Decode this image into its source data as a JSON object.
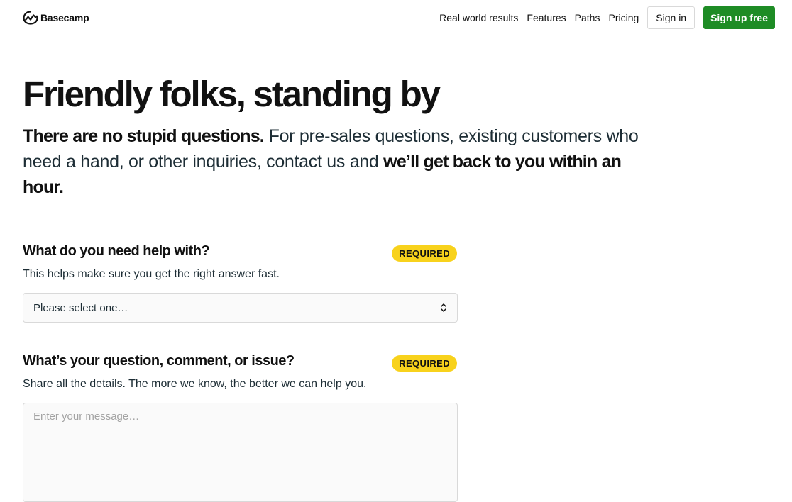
{
  "header": {
    "logo_text": "Basecamp",
    "nav": [
      {
        "label": "Real world results"
      },
      {
        "label": "Features"
      },
      {
        "label": "Paths"
      },
      {
        "label": "Pricing"
      }
    ],
    "signin_label": "Sign in",
    "signup_label": "Sign up free",
    "brand_green": "#1e8c25"
  },
  "hero": {
    "title": "Friendly folks, standing by",
    "intro_bold_1": "There are no stupid questions.",
    "intro_text": " For pre-sales questions, existing customers who need a hand, or other inquiries, contact us and ",
    "intro_bold_2": "we’ll get back to you within an hour."
  },
  "form": {
    "help_topic": {
      "label": "What do you need help with?",
      "badge": "REQUIRED",
      "help": "This helps make sure you get the right answer fast.",
      "selected": "Please select one…"
    },
    "question": {
      "label": "What’s your question, comment, or issue?",
      "badge": "REQUIRED",
      "help": "Share all the details. The more we know, the better we can help you.",
      "placeholder": "Enter your message…"
    },
    "badge_color": "#f8d21c"
  }
}
